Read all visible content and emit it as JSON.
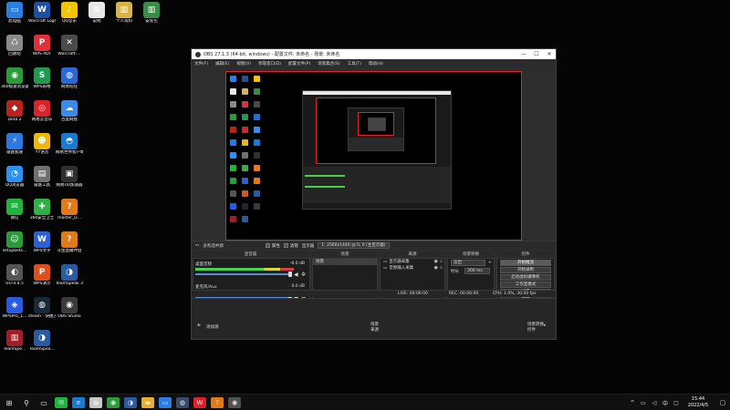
{
  "desktop": {
    "icons": [
      {
        "label": "此电脑",
        "icon": "computer-icon",
        "color": "#2a7de1",
        "glyph": "▭"
      },
      {
        "label": "Warcraft Logs - Co...",
        "icon": "warcraft-logs-icon",
        "color": "#1d4fa3",
        "glyph": "W"
      },
      {
        "label": "QQ音乐",
        "icon": "qq-music-icon",
        "color": "#f5c400",
        "glyph": "♪"
      },
      {
        "label": "说明",
        "icon": "text-file-icon",
        "color": "#e8e8e8",
        "glyph": "≡"
      },
      {
        "label": "个人资料",
        "icon": "zip-file-icon",
        "color": "#d9b24a",
        "glyph": "▥"
      },
      {
        "label": "安装包",
        "icon": "zip-file-icon",
        "color": "#3b8a4a",
        "glyph": "▥"
      },
      {
        "label": "回收站",
        "icon": "recycle-bin-icon",
        "color": "#8a8a8a",
        "glyph": "♺"
      },
      {
        "label": "WPS PDF",
        "icon": "wps-pdf-icon",
        "color": "#e0303a",
        "glyph": "P"
      },
      {
        "label": "Warcraft-...",
        "icon": "warcraft-icon",
        "color": "#4a4a4a",
        "glyph": "✕"
      },
      {
        "label": "360极速浏览器",
        "icon": "360-browser-icon",
        "color": "#2a9a3a",
        "glyph": "◉"
      },
      {
        "label": "WPS表格",
        "icon": "wps-sheet-icon",
        "color": "#1f9a4f",
        "glyph": "S"
      },
      {
        "label": "网易旺旺",
        "icon": "netease-icon",
        "color": "#2a6ad6",
        "glyph": "◍"
      },
      {
        "label": "Dota 2",
        "icon": "dota2-icon",
        "color": "#b8241c",
        "glyph": "◆"
      },
      {
        "label": "网易云音乐",
        "icon": "netease-music-icon",
        "color": "#d8232a",
        "glyph": "◎"
      },
      {
        "label": "百度网盘",
        "icon": "baidu-disk-icon",
        "color": "#3a8ae8",
        "glyph": "☁"
      },
      {
        "label": "雷霆加速",
        "icon": "thunder-accel-icon",
        "color": "#2a78e0",
        "glyph": "⚡"
      },
      {
        "label": "YY语音",
        "icon": "yy-voice-icon",
        "color": "#f0b800",
        "glyph": "☻"
      },
      {
        "label": "网易世界客户端",
        "icon": "netease-world-icon",
        "color": "#1a7ad0",
        "glyph": "◓"
      },
      {
        "label": "QQ浏览器",
        "icon": "qq-browser-icon",
        "color": "#2a92f0",
        "glyph": "◔"
      },
      {
        "label": "雷霆工具",
        "icon": "thunder-tool-icon",
        "color": "#707070",
        "glyph": "▤"
      },
      {
        "label": "网易UU加速器",
        "icon": "uu-accel-icon",
        "color": "#2f2f2f",
        "glyph": "▣"
      },
      {
        "label": "微信",
        "icon": "wechat-icon",
        "color": "#22b23e",
        "glyph": "✉"
      },
      {
        "label": "360安全卫士",
        "icon": "360-security-icon",
        "color": "#2fb245",
        "glyph": "✚"
      },
      {
        "label": "master_D...",
        "icon": "exe-file-icon",
        "color": "#e07a1a",
        "glyph": "?"
      },
      {
        "label": "setupbets...",
        "icon": "installer-icon",
        "color": "#2a9a3a",
        "glyph": "☺"
      },
      {
        "label": "WPS文字",
        "icon": "wps-writer-icon",
        "color": "#2a62d6",
        "glyph": "W"
      },
      {
        "label": "斗鱼直播伴侣",
        "icon": "douyu-icon",
        "color": "#e07a1a",
        "glyph": "?"
      },
      {
        "label": "UU-4.4.5",
        "icon": "uu-icon",
        "color": "#555555",
        "glyph": "◐"
      },
      {
        "label": "WPS演示",
        "icon": "wps-ppt-icon",
        "color": "#e0501a",
        "glyph": "P"
      },
      {
        "label": "TeamSpeak 3",
        "icon": "teamspeak-icon",
        "color": "#2a5aa0",
        "glyph": "◑"
      },
      {
        "label": "WPSPro_1...",
        "icon": "wps-pro-icon",
        "color": "#2a5ae0",
        "glyph": "◈"
      },
      {
        "label": "steam - 快捷方式",
        "icon": "steam-icon",
        "color": "#1b2838",
        "glyph": "◍"
      },
      {
        "label": "OBS Studio",
        "icon": "obs-icon",
        "color": "#3a3a3a",
        "glyph": "◉"
      },
      {
        "label": "TeamSpe...",
        "icon": "rar-file-icon",
        "color": "#a0202a",
        "glyph": "▥"
      },
      {
        "label": "TeamSpea...",
        "icon": "teamspeak-icon",
        "color": "#2a5aa0",
        "glyph": "◑"
      }
    ]
  },
  "taskbar": {
    "time": "15:44",
    "date": "2022/4/5",
    "apps": [
      {
        "icon": "windows-start-icon",
        "glyph": "⊞",
        "color": ""
      },
      {
        "icon": "search-icon",
        "glyph": "⚲",
        "color": ""
      },
      {
        "icon": "task-view-icon",
        "glyph": "▭",
        "color": ""
      },
      {
        "icon": "wechat-icon",
        "glyph": "✉",
        "color": "#22b23e"
      },
      {
        "icon": "edge-icon",
        "glyph": "e",
        "color": "#1a7ad0"
      },
      {
        "icon": "app-icon",
        "glyph": "▣",
        "color": "#c8c8c8"
      },
      {
        "icon": "360-browser-icon",
        "glyph": "◉",
        "color": "#2a9a3a"
      },
      {
        "icon": "teamspeak-icon",
        "glyph": "◑",
        "color": "#2a5aa0"
      },
      {
        "icon": "folder-icon",
        "glyph": "▬",
        "color": "#e8b030"
      },
      {
        "icon": "tv-icon",
        "glyph": "▭",
        "color": "#2a7de1"
      },
      {
        "icon": "steam-icon",
        "glyph": "◍",
        "color": "#3a4a6a"
      },
      {
        "icon": "wps-icon",
        "glyph": "W",
        "color": "#d8232a"
      },
      {
        "icon": "douyu-icon",
        "glyph": "?",
        "color": "#e07a1a"
      },
      {
        "icon": "obs-icon",
        "glyph": "◉",
        "color": "#505050"
      }
    ],
    "tray_icons": [
      "chevron-up-icon",
      "network-icon",
      "volume-icon",
      "ime-icon",
      "notification-icon"
    ],
    "tray_glyphs": [
      "^",
      "▭",
      "◁",
      "中",
      "▢"
    ]
  },
  "obs": {
    "title": "OBS 27.1.3 (64-bit, windows) - 配置文件: 未命名 - 场景: 未命名",
    "menu": [
      "文件(F)",
      "编辑(E)",
      "视图(V)",
      "停靠窗口(D)",
      "配置文件(P)",
      "场景集合(S)",
      "工具(T)",
      "帮助(H)"
    ],
    "toolbar": {
      "scene_none": "没有选中源",
      "properties": "属性",
      "filters": "滤镜",
      "source_label": "显示器",
      "source_value": "1: 2560x1440 @ 0, 0 (主显示器)"
    },
    "docks": {
      "mixer_title": "混音器",
      "scenes_title": "场景",
      "sources_title": "来源",
      "transitions_title": "场景转换",
      "controls_title": "控件"
    },
    "mixer": [
      {
        "name": "桌面音频",
        "db": "-6.0 dB"
      },
      {
        "name": "麦克风/Aux",
        "db": "0.0 dB"
      }
    ],
    "scenes": [
      "场景"
    ],
    "sources": [
      "显示器采集",
      "音频输入采集"
    ],
    "transitions": {
      "type": "淡出",
      "duration_label": "时长",
      "duration": "300 ms"
    },
    "controls": [
      "开始推流",
      "开始录制",
      "启动虚拟摄像机",
      "工作室模式",
      "设置",
      "退出"
    ],
    "status": {
      "live": "LIVE: 00:00:00",
      "rec": "REC: 00:00:00",
      "cpu": "CPU: 1.0%, 30.00 fps"
    },
    "bottom": {
      "left": "添加源",
      "center_top": "场景",
      "center_bottom": "来源",
      "right_top": "场景转换",
      "right_bottom": "控件"
    },
    "colors": {
      "preview_border": "#e1222a",
      "meter_green": "#4ad24a",
      "meter_yellow": "#d8d83a",
      "meter_red": "#d84040"
    }
  }
}
